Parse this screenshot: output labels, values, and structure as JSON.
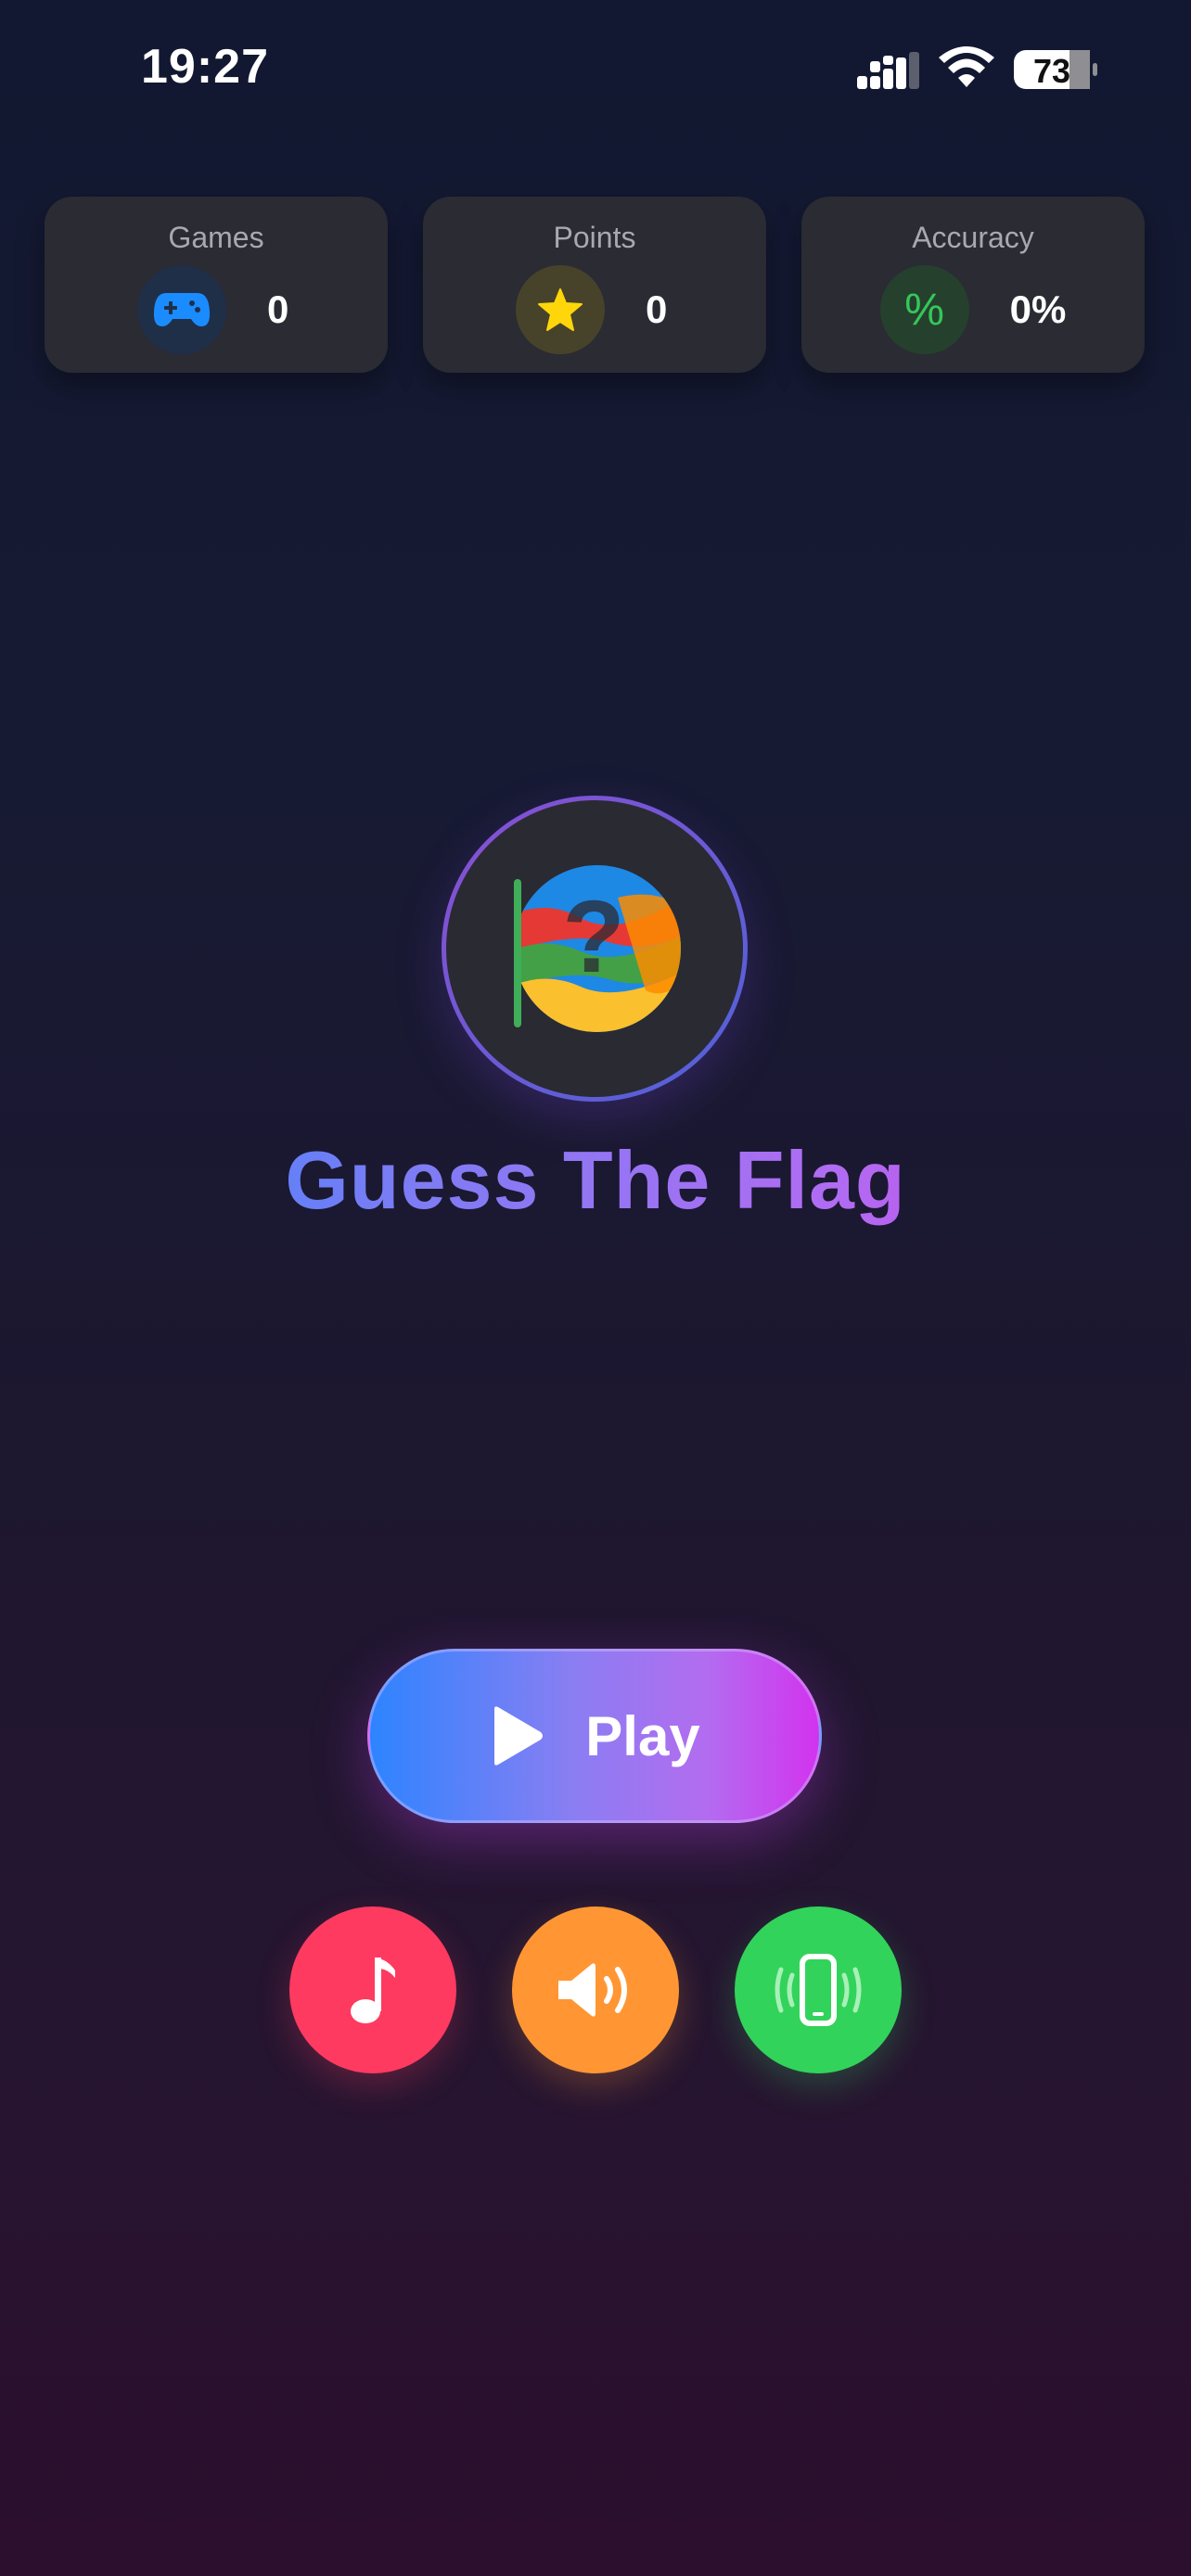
{
  "status_bar": {
    "time": "19:27",
    "battery": "73"
  },
  "stats": [
    {
      "label": "Games",
      "value": "0",
      "icon": "gamepad-icon",
      "color": "#1a8cff"
    },
    {
      "label": "Points",
      "value": "0",
      "icon": "star-icon",
      "color": "#ffd60a"
    },
    {
      "label": "Accuracy",
      "value": "0%",
      "icon": "percent-icon",
      "icon_text": "%",
      "color": "#34c759"
    }
  ],
  "logo": {
    "icon": "flag-question-icon",
    "mark": "?"
  },
  "title": "Guess The Flag",
  "play_button": {
    "label": "Play",
    "icon": "play-icon"
  },
  "controls": [
    {
      "name": "music",
      "icon": "music-note-icon",
      "color": "#ff3a61"
    },
    {
      "name": "sound",
      "icon": "speaker-icon",
      "color": "#ff9633"
    },
    {
      "name": "vibration",
      "icon": "phone-vibrate-icon",
      "color": "#32d35a"
    }
  ]
}
